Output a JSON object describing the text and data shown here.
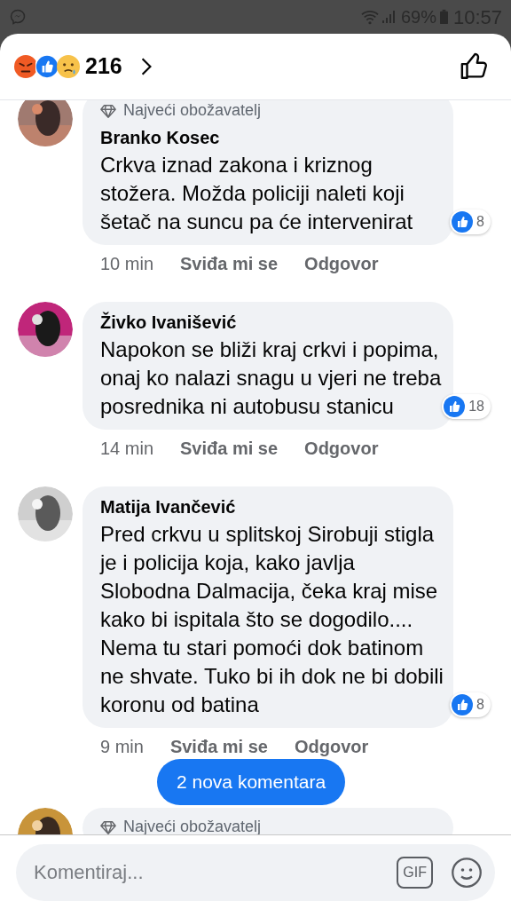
{
  "status_bar": {
    "battery": "69%",
    "time": "10:57"
  },
  "header": {
    "reaction_count": "216"
  },
  "comments": [
    {
      "badge": "Najveći obožavatelj",
      "name": "Branko Kosec",
      "text": "Crkva iznad zakona i kriznog stožera. Možda policiji naleti koji šetač na suncu pa će intervenirat",
      "reactions": "8",
      "time": "10 min",
      "like": "Sviđa mi se",
      "reply": "Odgovor"
    },
    {
      "name": "Živko Ivanišević",
      "text": "Napokon se bliži kraj crkvi i popima, onaj ko nalazi snagu u vjeri ne treba posrednika ni autobusu stanicu",
      "reactions": "18",
      "time": "14 min",
      "like": "Sviđa mi se",
      "reply": "Odgovor"
    },
    {
      "name": "Matija Ivančević",
      "text": "Pred crkvu u splitskoj Sirobuji stigla je i policija koja, kako javlja Slobodna Dalmacija, čeka kraj mise kako bi ispitala što se dogodilo.... Nema tu stari pomoći dok batinom ne shvate. Tuko bi ih dok ne bi dobili koronu od batina",
      "reactions": "8",
      "time": "9 min",
      "like": "Sviđa mi se",
      "reply": "Odgovor"
    },
    {
      "badge": "Najveći obožavatelj"
    }
  ],
  "new_comments_button": "2 nova komentara",
  "composer": {
    "placeholder": "Komentiraj...",
    "gif": "GIF"
  }
}
